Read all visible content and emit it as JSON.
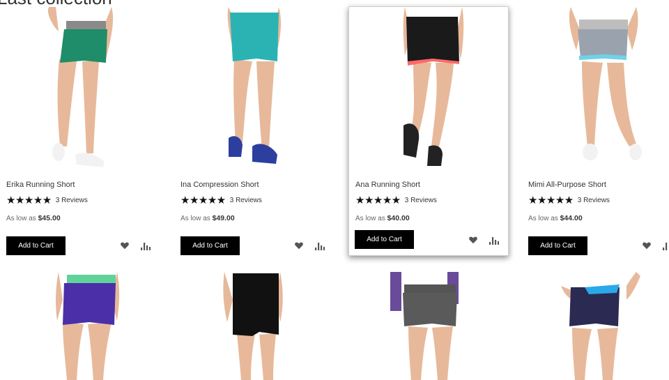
{
  "section": {
    "title": "Last collection"
  },
  "products": [
    {
      "name": "Erika Running Short",
      "stars": "★★★★★",
      "reviews": "3  Reviews",
      "price_prefix": "As low as ",
      "price": "$45.00",
      "cart_label": "Add to Cart",
      "colors": {
        "waistband": "#8a8a8a",
        "body": "#1f8c6a",
        "shoe": "#f2f2f2"
      }
    },
    {
      "name": "Ina Compression Short",
      "stars": "★★★★★",
      "reviews": "3  Reviews",
      "price_prefix": "As low as ",
      "price": "$49.00",
      "cart_label": "Add to Cart",
      "colors": {
        "waistband": "#2bb3b3",
        "body": "#2bb3b3",
        "shoe": "#2d3f9e"
      }
    },
    {
      "name": "Ana Running Short",
      "stars": "★★★★★",
      "reviews": "3  Reviews",
      "price_prefix": "As low as ",
      "price": "$40.00",
      "cart_label": "Add to Cart",
      "colors": {
        "waistband": "#1a1a1a",
        "body": "#1a1a1a",
        "shoe": "#222222",
        "trim": "#ff6a6a"
      }
    },
    {
      "name": "Mimi All-Purpose Short",
      "stars": "★★★★★",
      "reviews": "3  Reviews",
      "price_prefix": "As low as ",
      "price": "$44.00",
      "cart_label": "Add to Cart",
      "colors": {
        "waistband": "#bdbdbd",
        "body": "#9aa3ad",
        "shoe": "#f2f2f2",
        "trim": "#6fd3e8"
      }
    }
  ],
  "second_row": [
    {
      "waistband": "#5fd39a",
      "body": "#4b2fa8"
    },
    {
      "waistband": "#111111",
      "body": "#111111"
    },
    {
      "waistband": "#555555",
      "body": "#5a5a5a",
      "sleeve": "#6a4a9a"
    },
    {
      "waistband": "#2aa9e8",
      "body": "#2b2a52"
    }
  ],
  "icons": {
    "wishlist": "heart-icon",
    "compare": "compare-bars-icon"
  },
  "colors": {
    "button_bg": "#000000",
    "button_text": "#ffffff",
    "skin": "#e7b99a"
  }
}
